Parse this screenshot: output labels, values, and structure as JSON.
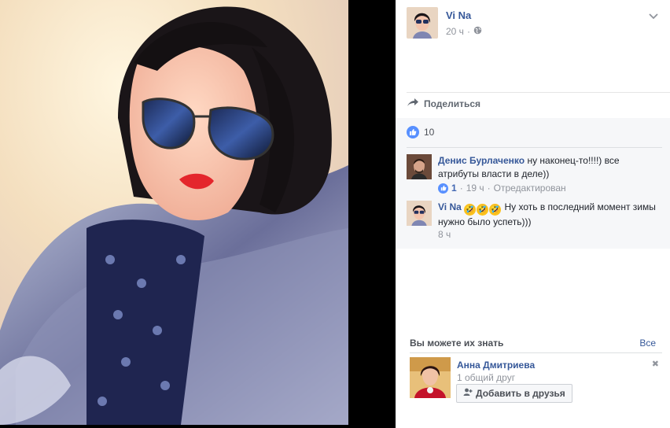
{
  "post": {
    "author": "Vi Na",
    "time": "20 ч",
    "privacy_icon": "globe-icon",
    "menu_icon": "chevron-down-icon"
  },
  "actions": {
    "share_label": "Поделиться"
  },
  "reactions": {
    "like_count": "10"
  },
  "comments": [
    {
      "author": "Денис Бурлаченко",
      "text": "ну наконец-то!!!!) все атрибуты власти в деле))",
      "likes": "1",
      "time": "19 ч",
      "edited": "Отредактирован"
    },
    {
      "author": "Vi Na",
      "emoji": [
        "🤣",
        "🤣",
        "🤣"
      ],
      "text": "Ну хоть в последний момент зимы нужно было успеть)))",
      "time": "8 ч"
    }
  ],
  "people_you_may_know": {
    "title": "Вы можете их знать",
    "see_all": "Все",
    "suggestion": {
      "name": "Анна Дмитриева",
      "mutual": "1 общий друг",
      "add_label": "Добавить в друзья"
    }
  },
  "colors": {
    "link": "#365899",
    "like_blue": "#5890ff",
    "panel_gray": "#f6f7f9"
  }
}
